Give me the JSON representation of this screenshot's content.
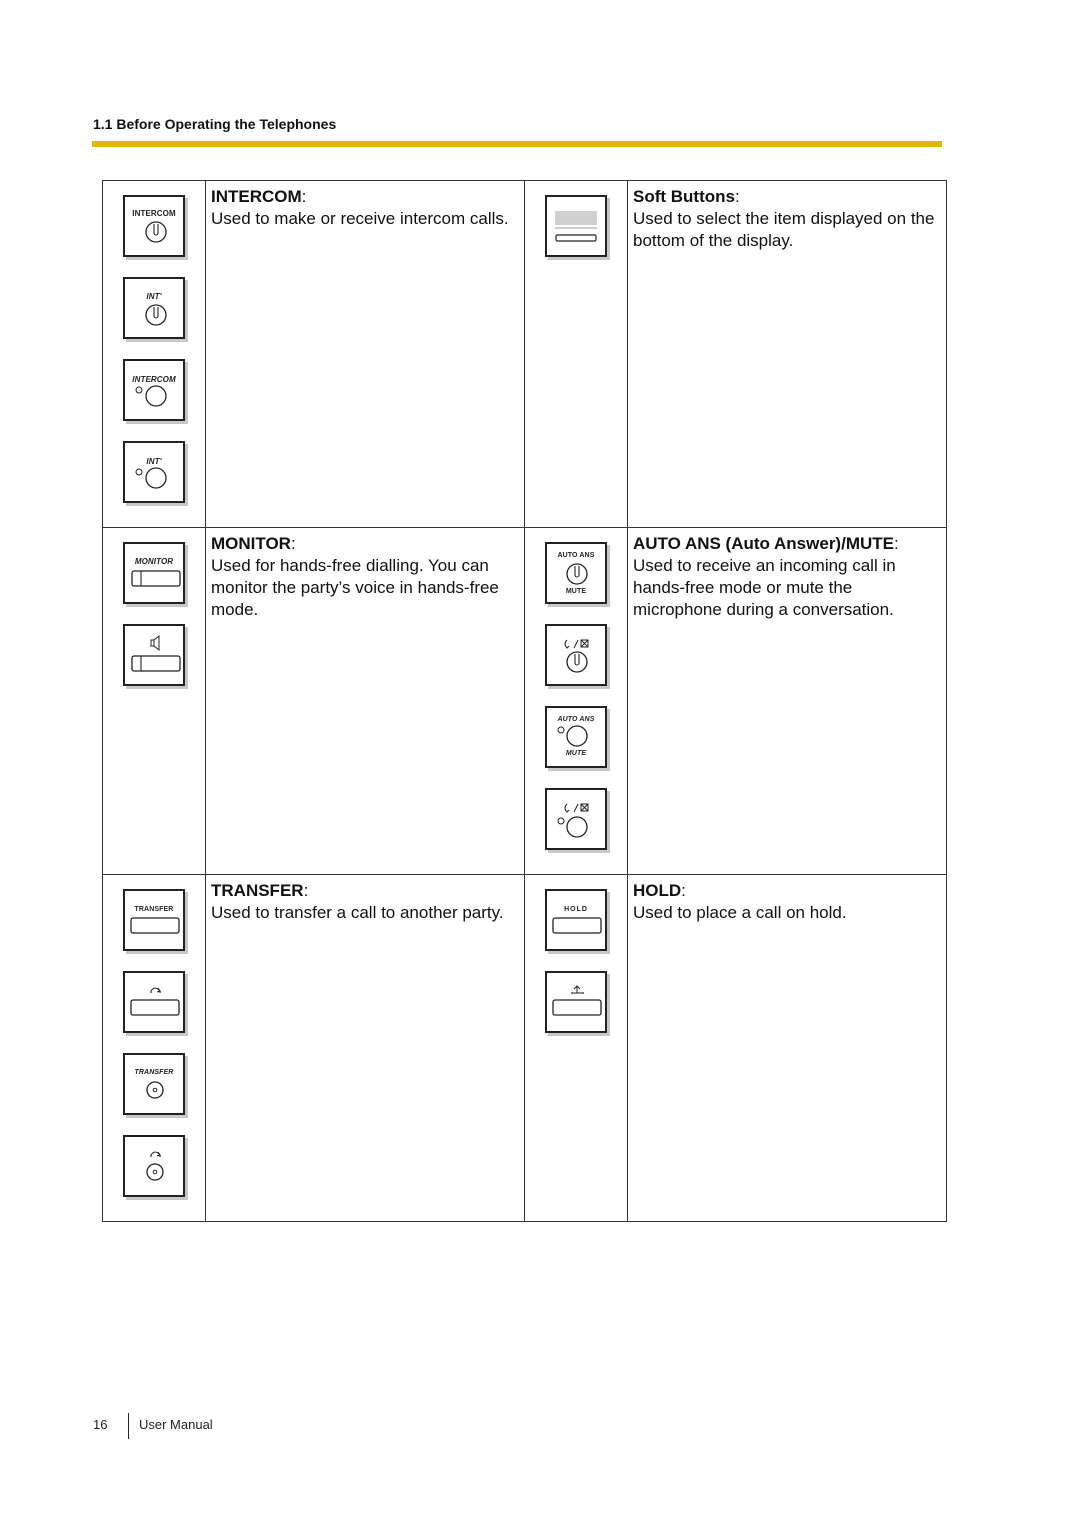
{
  "header": {
    "section_title": "1.1 Before Operating the Telephones",
    "accent_color": "#e0b800"
  },
  "rows": [
    {
      "left": {
        "title": "INTERCOM",
        "colon": ":",
        "description": "Used to make or receive intercom calls.",
        "keys": [
          {
            "label": "INTERCOM",
            "style": "bold",
            "icon": "round-button-icon"
          },
          {
            "label": "INT'",
            "style": "italic",
            "icon": "round-button-icon"
          },
          {
            "label": "INTERCOM",
            "style": "italic",
            "icon": "led-round-button-icon"
          },
          {
            "label": "INT'",
            "style": "italic",
            "icon": "led-round-button-icon"
          }
        ]
      },
      "right": {
        "title": "Soft Buttons",
        "colon": ":",
        "description": "Used to select the item displayed on the bottom of the display.",
        "keys": [
          {
            "label": "",
            "icon": "soft-button-icon"
          }
        ]
      }
    },
    {
      "left": {
        "title": "MONITOR",
        "colon": ":",
        "description": "Used for hands-free dialling. You can monitor the party’s voice in hands-free mode.",
        "keys": [
          {
            "label": "MONITOR",
            "style": "italic",
            "icon": "wide-button-icon"
          },
          {
            "label": "",
            "icon": "speaker-icon"
          }
        ]
      },
      "right": {
        "title": "AUTO ANS (Auto Answer)/MUTE",
        "colon": ":",
        "description": "Used to receive an incoming call in hands-free mode or mute the microphone during a conversation.",
        "keys": [
          {
            "label": "AUTO ANS",
            "label2": "MUTE",
            "style": "bold",
            "icon": "round-button-icon"
          },
          {
            "label": "",
            "icon": "auto-answer-mute-symbol-icon"
          },
          {
            "label": "AUTO ANS",
            "label2": "MUTE",
            "style": "italic",
            "icon": "led-round-button-icon"
          },
          {
            "label": "",
            "icon": "auto-answer-mute-symbol-led-icon"
          }
        ]
      }
    },
    {
      "left": {
        "title": "TRANSFER",
        "colon": ":",
        "description": "Used to transfer a call to another party.",
        "keys": [
          {
            "label": "TRANSFER",
            "style": "bold",
            "icon": "wide-button-icon"
          },
          {
            "label": "",
            "icon": "transfer-arrow-icon"
          },
          {
            "label": "TRANSFER",
            "style": "italic",
            "icon": "small-round-button-icon"
          },
          {
            "label": "",
            "icon": "transfer-arrow-round-icon"
          }
        ]
      },
      "right": {
        "title": "HOLD",
        "colon": ":",
        "description": "Used to place a call on hold.",
        "keys": [
          {
            "label": "HOLD",
            "style": "bold",
            "icon": "wide-button-icon"
          },
          {
            "label": "",
            "icon": "hold-arrow-icon"
          }
        ]
      }
    }
  ],
  "footer": {
    "page_number": "16",
    "label": "User Manual"
  }
}
